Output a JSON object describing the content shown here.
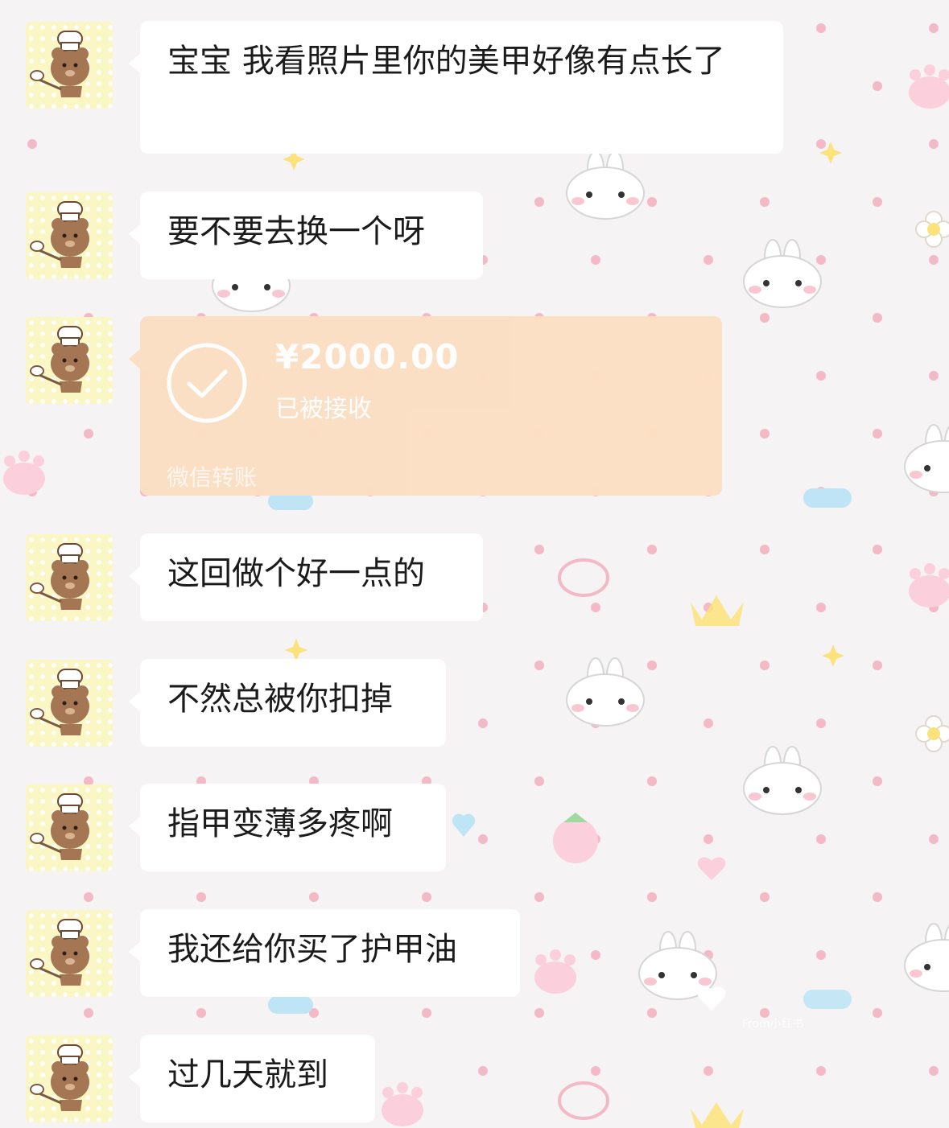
{
  "messages": [
    {
      "type": "text",
      "text": "宝宝 我看照片里你的美甲好像有点长了"
    },
    {
      "type": "text",
      "text": "要不要去换一个呀"
    },
    {
      "type": "transfer",
      "amount": "¥2000.00",
      "status": "已被接收",
      "service": "微信转账"
    },
    {
      "type": "text",
      "text": "这回做个好一点的"
    },
    {
      "type": "text",
      "text": "不然总被你扣掉"
    },
    {
      "type": "text",
      "text": "指甲变薄多疼啊"
    },
    {
      "type": "text",
      "text": "我还给你买了护甲油"
    },
    {
      "type": "text",
      "text": "过几天就到"
    }
  ],
  "watermark": "From小红书",
  "colors": {
    "bubble": "#ffffff",
    "transfer_bubble": "#fcdfc3",
    "avatar_bg": "#fbf7c4",
    "wallpaper": "#f5f3f4"
  },
  "icons": {
    "avatar": "chef-bear-avatar-icon",
    "transfer": "check-circle-icon"
  }
}
